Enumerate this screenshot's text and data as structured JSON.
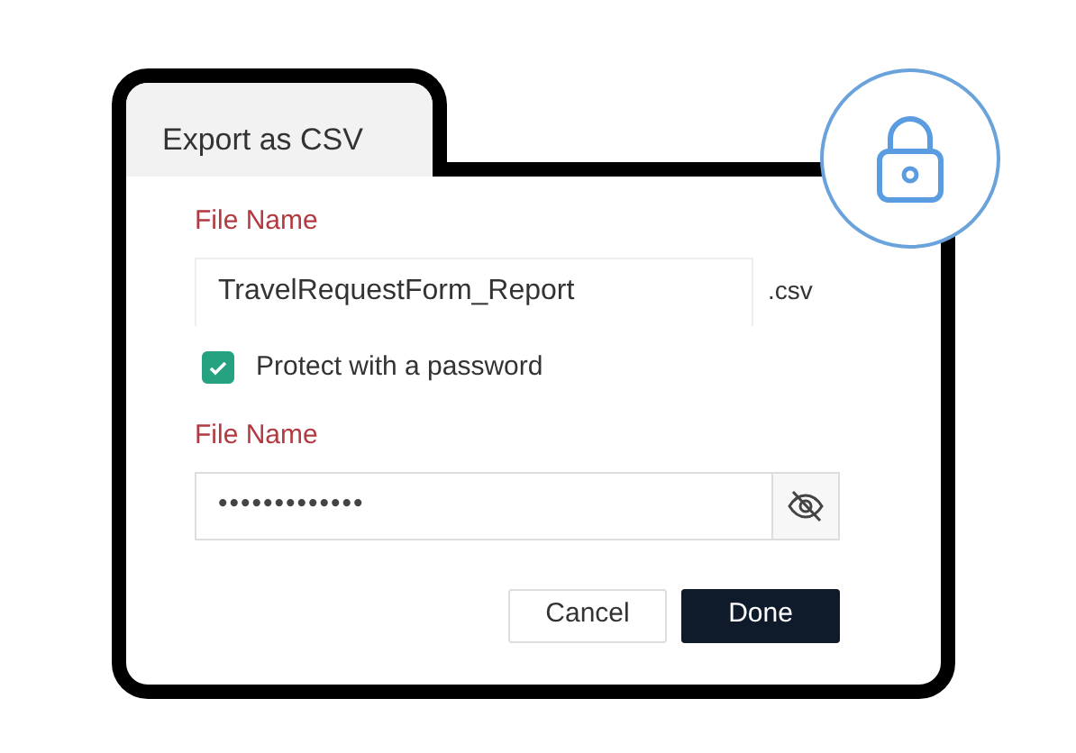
{
  "tab": {
    "label": "Export as CSV",
    "selected": true
  },
  "file_name": {
    "label": "File Name",
    "value": "TravelRequestForm_Report",
    "suffix": ".csv"
  },
  "protect": {
    "label": "Protect with a password",
    "checked": true
  },
  "password": {
    "label": "File Name",
    "value": "•••••••••••••"
  },
  "buttons": [
    {
      "label": "Cancel",
      "kind": "secondary"
    },
    {
      "label": "Done",
      "kind": "primary"
    }
  ]
}
